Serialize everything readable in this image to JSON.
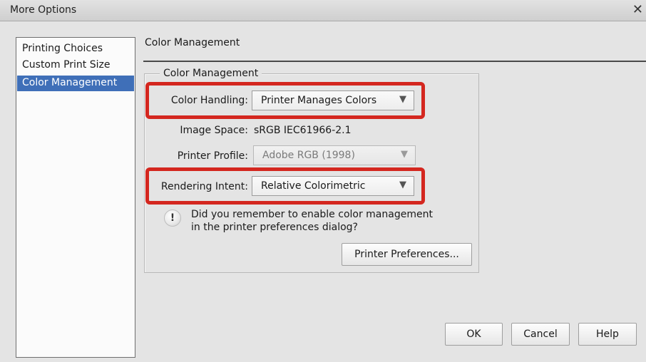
{
  "window": {
    "title": "More Options",
    "close_glyph": "✕"
  },
  "sidebar": {
    "items": [
      {
        "label": "Printing Choices"
      },
      {
        "label": "Custom Print Size"
      },
      {
        "label": "Color Management",
        "selected": true
      }
    ]
  },
  "section": {
    "heading": "Color Management",
    "group_title": "Color Management"
  },
  "color_handling": {
    "label": "Color Handling:",
    "value": "Printer Manages Colors"
  },
  "image_space": {
    "label": "Image Space:",
    "value": "sRGB IEC61966-2.1"
  },
  "printer_profile": {
    "label": "Printer Profile:",
    "value": "Adobe RGB (1998)",
    "disabled": true
  },
  "rendering_intent": {
    "label": "Rendering Intent:",
    "value": "Relative Colorimetric"
  },
  "note": {
    "icon": "info-icon",
    "line1": "Did you remember to enable color management",
    "line2": "in the printer preferences dialog?"
  },
  "buttons": {
    "printer_preferences": "Printer Preferences...",
    "ok": "OK",
    "cancel": "Cancel",
    "help": "Help"
  },
  "colors": {
    "highlight": "#d4271f",
    "selection": "#3f6fb8"
  }
}
